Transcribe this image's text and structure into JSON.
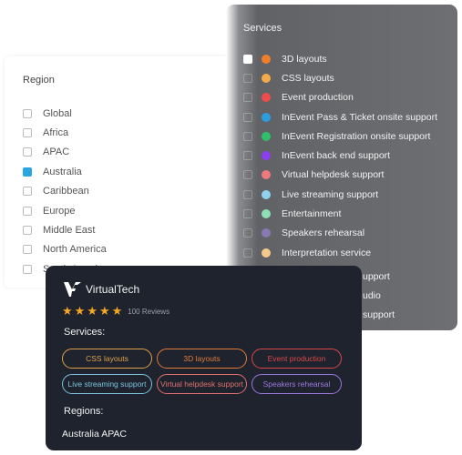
{
  "region_panel": {
    "title": "Region",
    "items": [
      {
        "label": "Global",
        "checked": false
      },
      {
        "label": "Africa",
        "checked": false
      },
      {
        "label": "APAC",
        "checked": false
      },
      {
        "label": "Australia",
        "checked": true
      },
      {
        "label": "Caribbean",
        "checked": false
      },
      {
        "label": "Europe",
        "checked": false
      },
      {
        "label": "Middle East",
        "checked": false
      },
      {
        "label": "North America",
        "checked": false
      },
      {
        "label": "South America",
        "checked": false
      }
    ]
  },
  "services_panel": {
    "title": "Services",
    "items": [
      {
        "label": "3D layouts",
        "color": "#f07f2a",
        "checked": true
      },
      {
        "label": "CSS layouts",
        "color": "#f5a94a"
      },
      {
        "label": "Event production",
        "color": "#ef4b4b"
      },
      {
        "label": "InEvent Pass & Ticket onsite support",
        "color": "#2a9ee0"
      },
      {
        "label": "InEvent Registration onsite support",
        "color": "#2ec16a"
      },
      {
        "label": "InEvent back end support",
        "color": "#8c3ff0"
      },
      {
        "label": "Virtual helpdesk support",
        "color": "#f07a7a"
      },
      {
        "label": "Live streaming support",
        "color": "#8fd2f0"
      },
      {
        "label": "Entertainment",
        "color": "#8ee0b4"
      },
      {
        "label": "Speakers rehearsal",
        "color": "#8a78b4"
      },
      {
        "label": "Interpretation service",
        "color": "#f5c98a"
      }
    ],
    "partial_items": [
      "upport",
      "udio",
      "support"
    ]
  },
  "card": {
    "vendor": "VirtualTech",
    "rating": 5,
    "reviews": "100 Reviews",
    "services_heading": "Services:",
    "tags": [
      {
        "label": "CSS layouts",
        "color": "#e0a04a"
      },
      {
        "label": "3D layouts",
        "color": "#e07a3a"
      },
      {
        "label": "Event production",
        "color": "#d94848"
      },
      {
        "label": "Live streaming support",
        "color": "#7cc4e0"
      },
      {
        "label": "Virtual helpdesk support",
        "color": "#e07070"
      },
      {
        "label": "Speakers rehearsal",
        "color": "#9a78e0"
      }
    ],
    "regions_heading": "Regions:",
    "regions_value": "Australia APAC"
  }
}
